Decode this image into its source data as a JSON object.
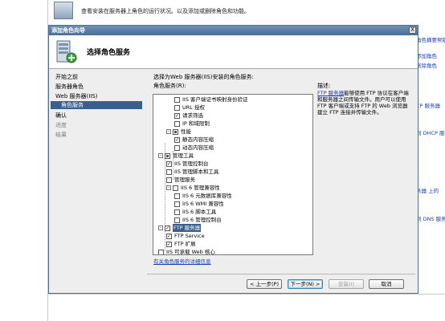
{
  "background": {
    "top_text": "查看安装在服务器上角色的运行状况。以及添加或删除角色和功能。",
    "right_links": [
      "角色摘要帮助",
      "添加角色",
      "删除角色",
      "CP 服务器",
      "到 DHCP 服务",
      "务器 上的",
      "到 DNS 服务"
    ]
  },
  "dialog": {
    "title": "添加角色向导",
    "close_label": "X",
    "header_title": "选择角色服务"
  },
  "nav": {
    "items": [
      {
        "label": "开始之前"
      },
      {
        "label": "服务器角色"
      },
      {
        "label": "Web 服务器(IIS)"
      },
      {
        "label": "角色服务"
      },
      {
        "label": "确认"
      },
      {
        "label": "进度"
      },
      {
        "label": "结果"
      }
    ]
  },
  "content": {
    "instruction": "选择为Web 服务器(IIS)安装的角色服务:",
    "list_label": "角色服务(R):",
    "description_label": "描述:",
    "description_link": "FTP 服务器",
    "description_body": "能够使用 FTP 协议在客户端和服务器之间传输文件。用户可以使用 FTP 客户端或支持 FTP 的 Web 浏览器建立 FTP 连接并传输文件。",
    "more_info_link": "有关角色服务的详细信息",
    "tree": [
      {
        "label": "IIS 客户端证书映射身份验证",
        "state": "unchecked"
      },
      {
        "label": "URL 授权",
        "state": "unchecked"
      },
      {
        "label": "请求筛选",
        "state": "checked"
      },
      {
        "label": "IP 和域限制",
        "state": "unchecked"
      },
      {
        "label": "性能",
        "state": "partial"
      },
      {
        "label": "静态内容压缩",
        "state": "checked"
      },
      {
        "label": "动态内容压缩",
        "state": "unchecked"
      },
      {
        "label": "管理工具",
        "state": "partial"
      },
      {
        "label": "IIS 管理控制台",
        "state": "checked"
      },
      {
        "label": "IIS 管理脚本和工具",
        "state": "unchecked"
      },
      {
        "label": "管理服务",
        "state": "unchecked"
      },
      {
        "label": "IIS 6 管理兼容性",
        "state": "unchecked"
      },
      {
        "label": "IIS 6 元数据库兼容性",
        "state": "unchecked"
      },
      {
        "label": "IIS 6 WMI 兼容性",
        "state": "unchecked"
      },
      {
        "label": "IIS 6 脚本工具",
        "state": "unchecked"
      },
      {
        "label": "IIS 6 管理控制台",
        "state": "unchecked"
      },
      {
        "label": "FTP 服务器",
        "state": "checked"
      },
      {
        "label": "FTP Service",
        "state": "checked"
      },
      {
        "label": "FTP 扩展",
        "state": "checked"
      },
      {
        "label": "IIS 可承载 Web 核心",
        "state": "unchecked"
      }
    ]
  },
  "buttons": {
    "back": "< 上一步(P)",
    "next": "下一步(N) >",
    "install": "安装(I)",
    "cancel": "取消"
  }
}
